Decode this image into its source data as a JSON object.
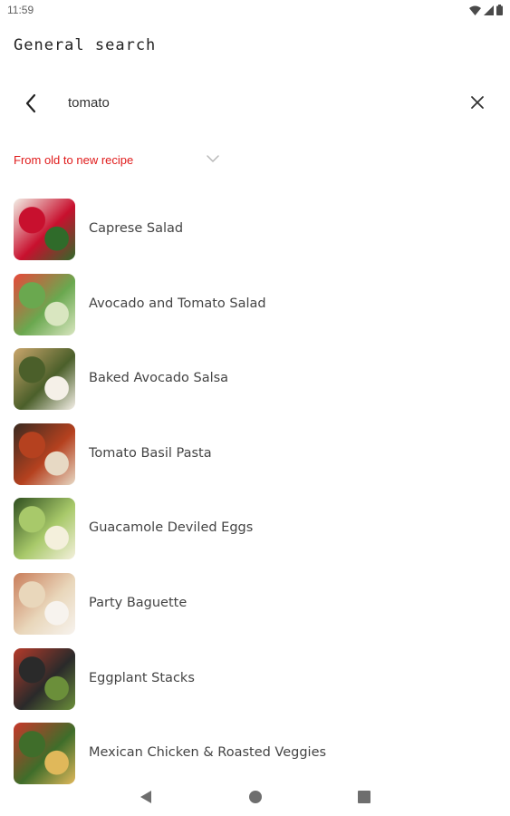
{
  "status_bar": {
    "time": "11:59",
    "icons": [
      "wifi-icon",
      "signal-icon",
      "battery-icon"
    ]
  },
  "header": {
    "title": "General search"
  },
  "search": {
    "value": "tomato",
    "back_icon": "chevron-left-icon",
    "clear_icon": "close-icon"
  },
  "sort": {
    "label": "From old to new recipe",
    "icon": "chevron-down-icon"
  },
  "recipes": [
    {
      "name": "Caprese Salad",
      "thumb_colors": [
        "#c8102e",
        "#f3efe6",
        "#2f6b2a"
      ]
    },
    {
      "name": "Avocado and Tomato Salad",
      "thumb_colors": [
        "#6aa84f",
        "#e8483a",
        "#d9e6c0"
      ]
    },
    {
      "name": "Baked Avocado Salsa",
      "thumb_colors": [
        "#4b5f2a",
        "#c9a56b",
        "#f5f0e8"
      ]
    },
    {
      "name": "Tomato Basil Pasta",
      "thumb_colors": [
        "#b5411f",
        "#3a2a20",
        "#e7d9c4"
      ]
    },
    {
      "name": "Guacamole Deviled Eggs",
      "thumb_colors": [
        "#a8c96a",
        "#2f4f1f",
        "#f4f0dc"
      ]
    },
    {
      "name": "Party Baguette",
      "thumb_colors": [
        "#e9d7bb",
        "#c97d5a",
        "#f7f3ee"
      ]
    },
    {
      "name": "Eggplant Stacks",
      "thumb_colors": [
        "#2a2a2a",
        "#b53a2a",
        "#6b8f3a"
      ]
    },
    {
      "name": "Mexican Chicken & Roasted Veggies",
      "thumb_colors": [
        "#3f6d2a",
        "#c8372a",
        "#e0b85a"
      ]
    }
  ],
  "nav_bar": {
    "items": [
      "back-triangle-icon",
      "home-circle-icon",
      "recents-square-icon"
    ]
  },
  "colors": {
    "accent": "#e01b1b",
    "text": "#444444"
  }
}
